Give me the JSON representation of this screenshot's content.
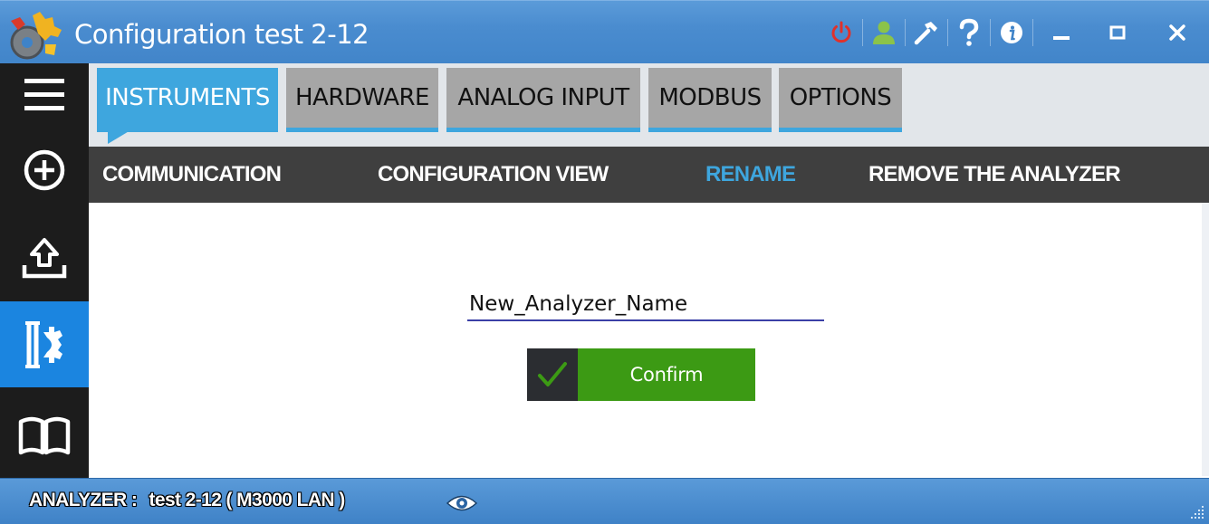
{
  "window": {
    "title": "Configuration test 2-12",
    "icons": [
      "power-icon",
      "user-icon",
      "tools-icon",
      "help-icon",
      "info-icon",
      "minimize-icon",
      "maximize-icon",
      "close-icon"
    ],
    "power_color": "#e0312b",
    "user_color": "#8bc34a"
  },
  "rail": {
    "items": [
      "menu-icon",
      "add-icon",
      "upload-icon",
      "configure-icon",
      "manual-icon"
    ],
    "active_item": "configure-icon",
    "active_color": "#1b85e0"
  },
  "tabs": [
    {
      "label": "INSTRUMENTS",
      "active": true
    },
    {
      "label": "HARDWARE",
      "active": false
    },
    {
      "label": "ANALOG INPUT",
      "active": false
    },
    {
      "label": "MODBUS",
      "active": false
    },
    {
      "label": "OPTIONS",
      "active": false
    }
  ],
  "accent_color": "#3ea6de",
  "subnav": [
    {
      "label": "COMMUNICATION",
      "active": false
    },
    {
      "label": "CONFIGURATION VIEW",
      "active": false
    },
    {
      "label": "RENAME",
      "active": true
    },
    {
      "label": "REMOVE THE ANALYZER",
      "active": false
    }
  ],
  "rename": {
    "value": "New_Analyzer_Name",
    "confirm_label": "Confirm",
    "confirm_color": "#3c9a14"
  },
  "status": {
    "label": "ANALYZER :",
    "value": "test 2-12 ( M3000 LAN )"
  }
}
